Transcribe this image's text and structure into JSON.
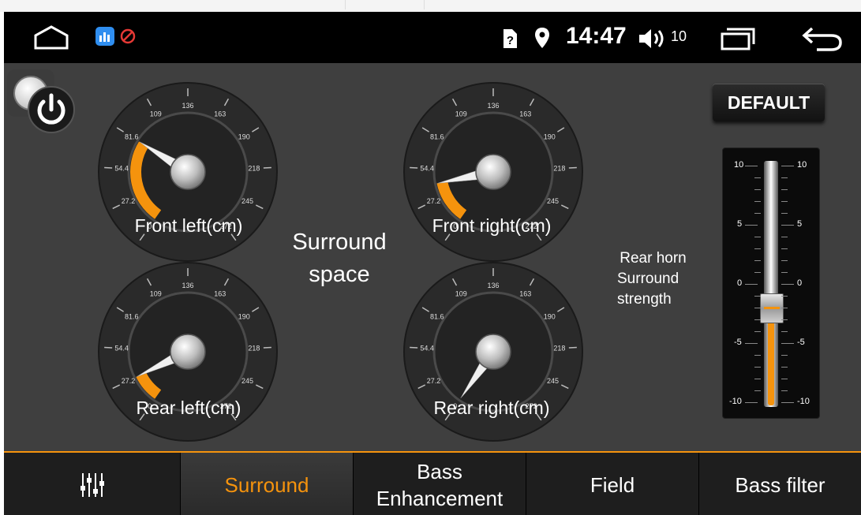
{
  "status_bar": {
    "time": "14:47",
    "volume": "10",
    "icons": [
      "home-icon",
      "app-icon",
      "blocked-icon",
      "sim-question-icon",
      "location-icon",
      "speaker-icon",
      "recent-apps-icon",
      "back-icon"
    ]
  },
  "gauges": [
    {
      "key": "front_left",
      "label": "Front left(cm)",
      "value": 81.6
    },
    {
      "key": "front_right",
      "label": "Front right(cm)",
      "value": 40.8
    },
    {
      "key": "rear_left",
      "label": "Rear left(cm)",
      "value": 27.2
    },
    {
      "key": "rear_right",
      "label": "Rear right(cm)",
      "value": 0
    }
  ],
  "gauge_ticks": [
    "0",
    "27.2",
    "54.4",
    "81.6",
    "109",
    "136",
    "163",
    "190",
    "218",
    "245",
    "272"
  ],
  "gauge_max": 272,
  "surround_title_line1": "Surround",
  "surround_title_line2": "space",
  "default_button": "DEFAULT",
  "rear_horn": {
    "line1": "Rear horn",
    "line2": "Surround",
    "line3": "strength"
  },
  "slider": {
    "value": -2,
    "min": -10,
    "max": 10,
    "labels": [
      "10",
      "5",
      "0",
      "-5",
      "-10"
    ]
  },
  "tabs": [
    {
      "label": "",
      "icon": "equalizer-icon"
    },
    {
      "label": "Surround",
      "active": true
    },
    {
      "label": "Bass Enhancement"
    },
    {
      "label": "Field"
    },
    {
      "label": "Bass filter"
    }
  ],
  "colors": {
    "accent": "#f5930d",
    "background": "#3f3f3f",
    "status_bar": "#000000"
  }
}
